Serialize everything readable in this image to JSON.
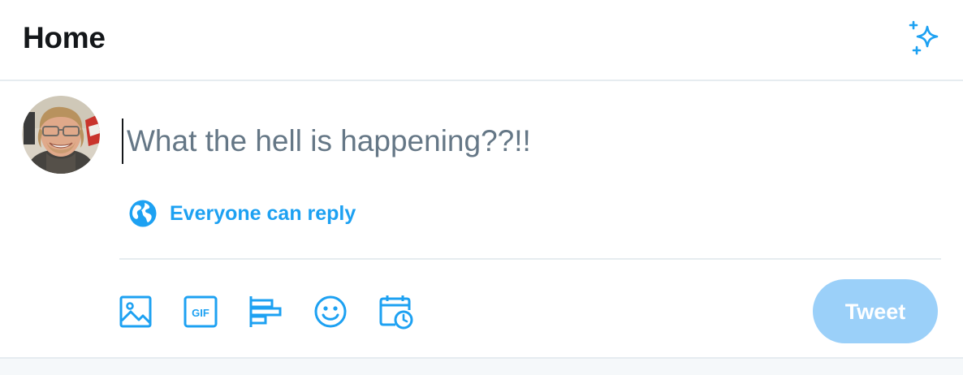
{
  "header": {
    "title": "Home",
    "top_tweets_icon": "sparkle-icon"
  },
  "composer": {
    "avatar_icon": "user-avatar",
    "placeholder": "What the hell is happening??!!",
    "value": "",
    "reply_setting": {
      "icon": "globe-icon",
      "label": "Everyone can reply"
    },
    "toolbar": [
      {
        "name": "media",
        "icon": "image-icon"
      },
      {
        "name": "gif",
        "icon": "gif-icon"
      },
      {
        "name": "poll",
        "icon": "poll-icon"
      },
      {
        "name": "emoji",
        "icon": "emoji-icon"
      },
      {
        "name": "schedule",
        "icon": "schedule-icon"
      }
    ],
    "tweet_button": {
      "label": "Tweet",
      "enabled": false
    }
  },
  "colors": {
    "accent": "#1da1f2",
    "tweet_button_disabled": "#9bd0f9",
    "divider": "#e6ecf0",
    "placeholder_text": "#657786",
    "title_text": "#14171a"
  }
}
